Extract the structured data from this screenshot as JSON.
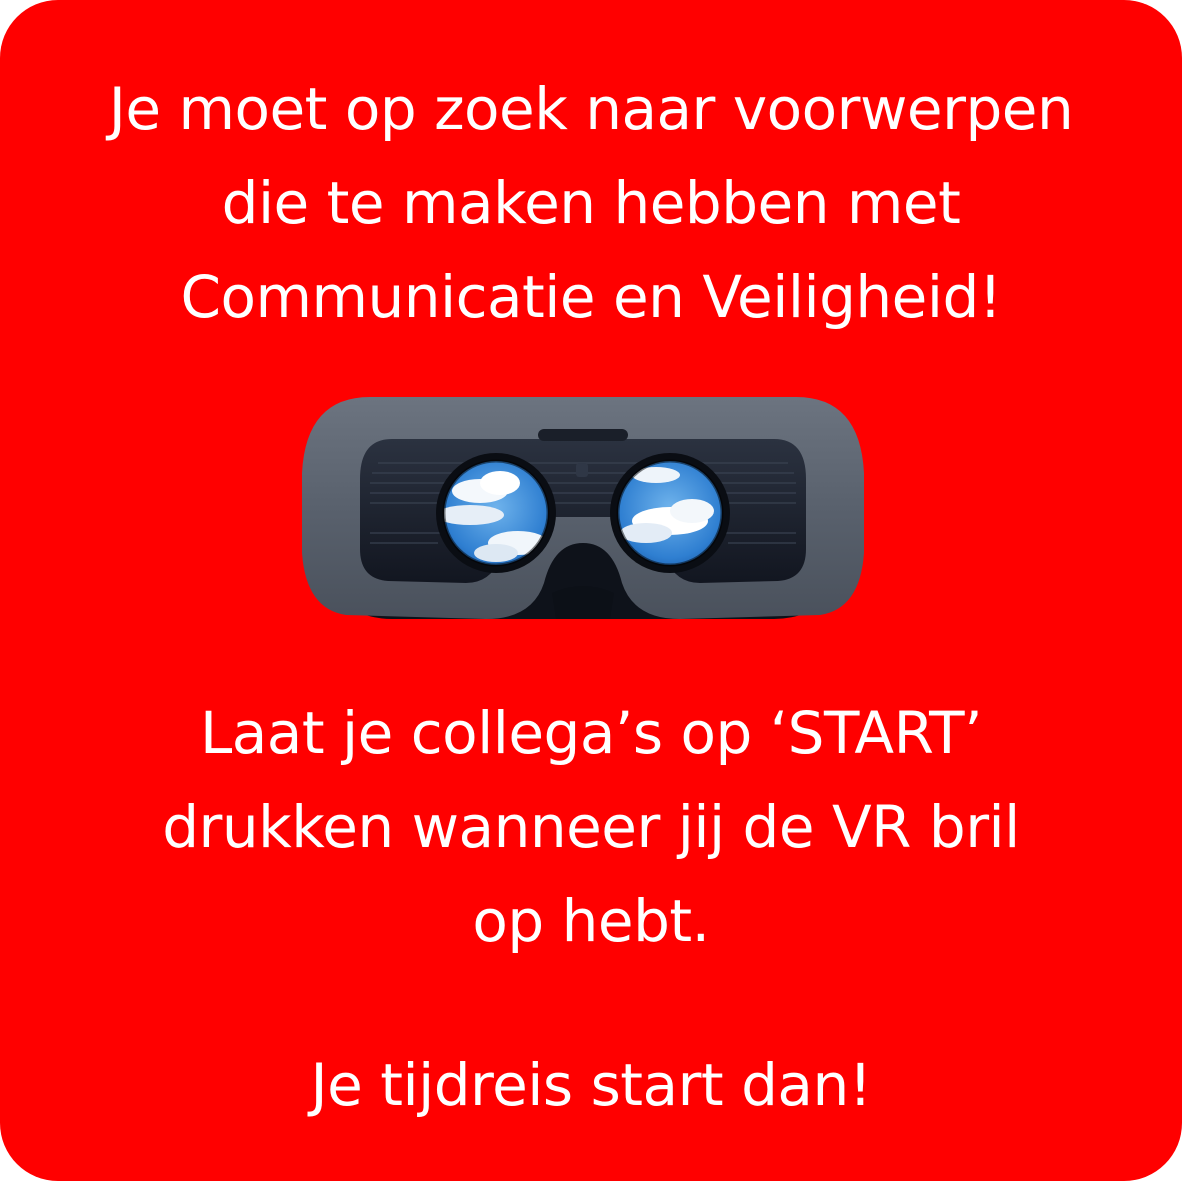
{
  "background_color": "#ff0000",
  "text_color": "#ffffff",
  "intro": {
    "lines": [
      "Je moet op zoek naar voorwerpen",
      "die te maken hebben met",
      "Communicatie en Veiligheid!"
    ]
  },
  "illustration": {
    "icon": "vr-headset-icon"
  },
  "instruction": {
    "lines": [
      "Laat je collega’s op ‘START’",
      "drukken wanneer jij de VR bril",
      "op hebt."
    ]
  },
  "closing": {
    "text": "Je tijdreis start dan!"
  }
}
